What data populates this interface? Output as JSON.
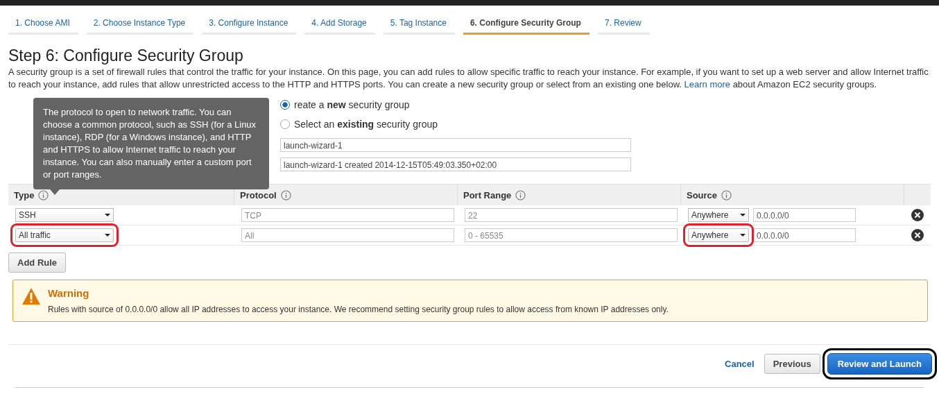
{
  "tabs": [
    {
      "label": "1. Choose AMI",
      "selected": false
    },
    {
      "label": "2. Choose Instance Type",
      "selected": false
    },
    {
      "label": "3. Configure Instance",
      "selected": false
    },
    {
      "label": "4. Add Storage",
      "selected": false
    },
    {
      "label": "5. Tag Instance",
      "selected": false
    },
    {
      "label": "6. Configure Security Group",
      "selected": true
    },
    {
      "label": "7. Review",
      "selected": false
    }
  ],
  "heading": "Step 6: Configure Security Group",
  "intro": {
    "text": "A security group is a set of firewall rules that control the traffic for your instance. On this page, you can add rules to allow specific traffic to reach your instance. For example, if you want to set up a web server and allow Internet traffic to reach your instance, add rules that allow unrestricted access to the HTTP and HTTPS ports. You can create a new security group or select from an existing one below.",
    "link": "Learn more",
    "after": "about Amazon EC2 security groups."
  },
  "security_group": {
    "options": [
      {
        "label": "reate a **new** security group",
        "selected": true
      },
      {
        "label": "Select an **existing** security group",
        "selected": false
      }
    ],
    "name_value": "launch-wizard-1",
    "description_value": "launch-wizard-1 created 2014-12-15T05:49:03.350+02:00"
  },
  "tooltip": "The protocol to open to network traffic. You can choose a common protocol, such as SSH (for a Linux instance), RDP (for a Windows instance), and HTTP and HTTPS to allow Internet traffic to reach your instance. You can also manually enter a custom port or port ranges.",
  "table": {
    "columns": [
      "Type",
      "Protocol",
      "Port Range",
      "Source"
    ],
    "rows": [
      {
        "type": "SSH",
        "protocol": "TCP",
        "port_range": "22",
        "source": "Anywhere",
        "cidr": "0.0.0.0/0",
        "circled": false
      },
      {
        "type": "All traffic",
        "protocol": "All",
        "port_range": "0 - 65535",
        "source": "Anywhere",
        "cidr": "0.0.0.0/0",
        "circled": true
      }
    ]
  },
  "add_rule": "Add Rule",
  "warning": {
    "title": "Warning",
    "text": "Rules with source of 0.0.0.0/0 allow all IP addresses to access your instance. We recommend setting security group rules to allow access from known IP addresses only."
  },
  "footer": {
    "cancel": "Cancel",
    "previous": "Previous",
    "review": "Review and Launch",
    "review_circled": true
  }
}
